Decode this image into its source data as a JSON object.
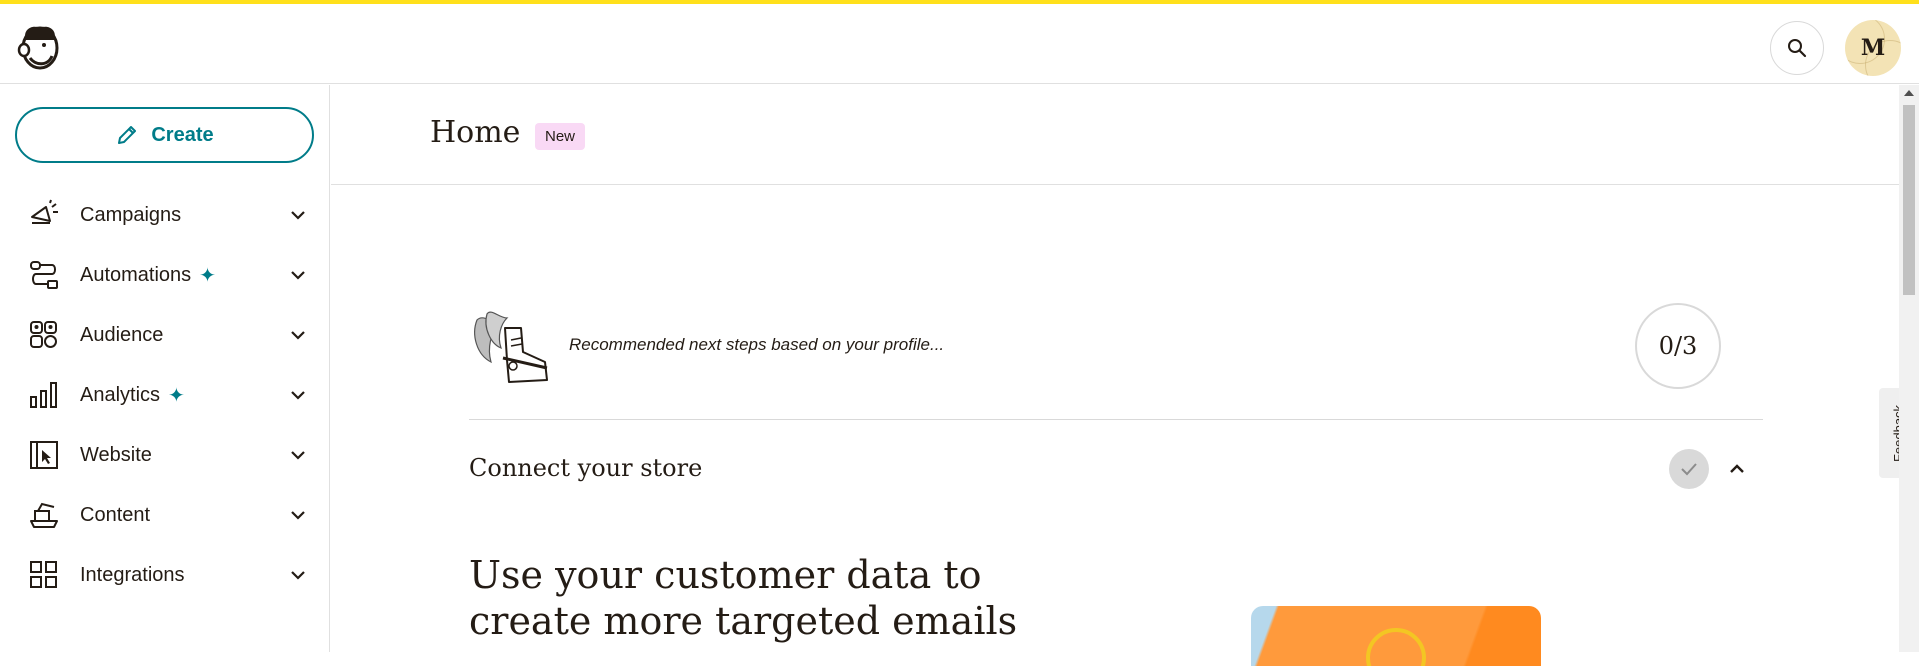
{
  "header": {
    "logo_icon": "mailchimp-freddie-logo",
    "search_icon": "search-icon",
    "avatar_initial": "M"
  },
  "sidebar": {
    "create_label": "Create",
    "create_icon": "pencil-icon",
    "items": [
      {
        "label": "Campaigns",
        "icon": "megaphone-icon",
        "sparkle": false
      },
      {
        "label": "Automations",
        "icon": "automation-flow-icon",
        "sparkle": true
      },
      {
        "label": "Audience",
        "icon": "audience-icon",
        "sparkle": false
      },
      {
        "label": "Analytics",
        "icon": "bar-chart-icon",
        "sparkle": true
      },
      {
        "label": "Website",
        "icon": "website-cursor-icon",
        "sparkle": false
      },
      {
        "label": "Content",
        "icon": "content-icon",
        "sparkle": false
      },
      {
        "label": "Integrations",
        "icon": "grid-icon",
        "sparkle": false
      }
    ],
    "sparkle_glyph": "✦"
  },
  "main": {
    "page_title": "Home",
    "badge": "New",
    "steps_text": "Recommended next steps based on your profile...",
    "progress": "0/3",
    "section_title": "Connect your store",
    "hero_line1": "Use your customer data to",
    "hero_line2": "create more targeted emails"
  },
  "feedback_label": "Feedback",
  "colors": {
    "accent": "#007c89",
    "brand_yellow": "#ffe01b",
    "badge_bg": "#f9d9f5",
    "text": "#241c15"
  }
}
